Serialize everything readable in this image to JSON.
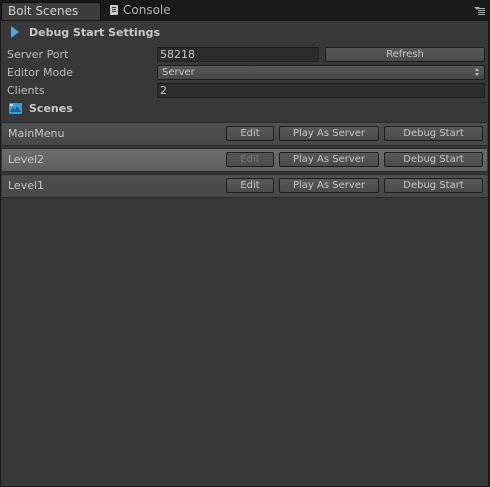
{
  "tabs": [
    {
      "label": "Bolt Scenes",
      "active": true
    },
    {
      "label": "Console",
      "active": false,
      "icon": "console-icon"
    }
  ],
  "debug_start": {
    "title": "Debug Start Settings",
    "server_port_label": "Server Port",
    "server_port_value": "58218",
    "refresh_label": "Refresh",
    "editor_mode_label": "Editor Mode",
    "editor_mode_value": "Server",
    "clients_label": "Clients",
    "clients_value": "2"
  },
  "scenes": {
    "title": "Scenes",
    "rows": [
      {
        "name": "MainMenu",
        "edit": "Edit",
        "play_server": "Play As Server",
        "debug": "Debug Start",
        "edit_enabled": true
      },
      {
        "name": "Level2",
        "edit": "Edit",
        "play_server": "Play As Server",
        "debug": "Debug Start",
        "edit_enabled": false
      },
      {
        "name": "Level1",
        "edit": "Edit",
        "play_server": "Play As Server",
        "debug": "Debug Start",
        "edit_enabled": true
      }
    ]
  },
  "colors": {
    "accent": "#4aa8e0",
    "panel": "#383838",
    "background": "#191919"
  }
}
